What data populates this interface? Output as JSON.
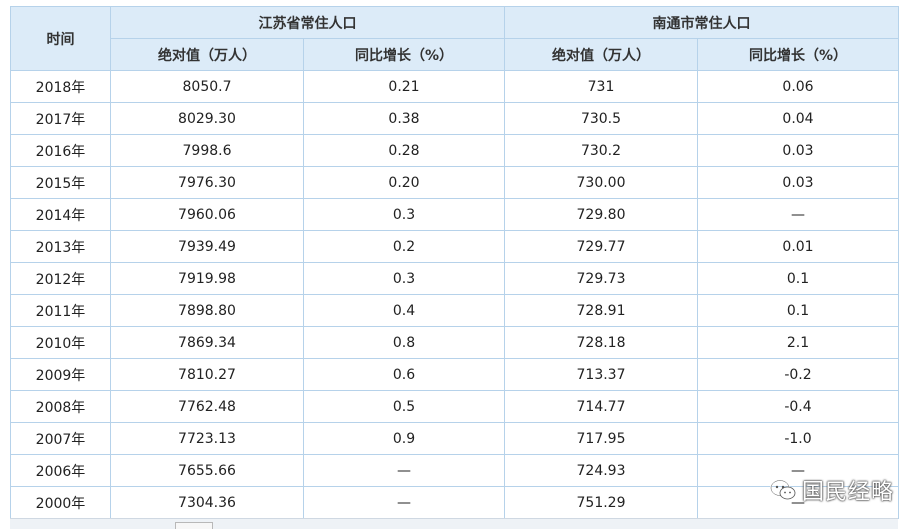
{
  "header": {
    "time": "时间",
    "group_js": "江苏省常住人口",
    "group_nt": "南通市常住人口",
    "abs": "绝对值（万人）",
    "yoy": "同比增长（%）"
  },
  "rows": [
    {
      "year": "2018年",
      "js_abs": "8050.7",
      "js_yoy": "0.21",
      "nt_abs": "731",
      "nt_yoy": "0.06"
    },
    {
      "year": "2017年",
      "js_abs": "8029.30",
      "js_yoy": "0.38",
      "nt_abs": "730.5",
      "nt_yoy": "0.04"
    },
    {
      "year": "2016年",
      "js_abs": "7998.6",
      "js_yoy": "0.28",
      "nt_abs": "730.2",
      "nt_yoy": "0.03"
    },
    {
      "year": "2015年",
      "js_abs": "7976.30",
      "js_yoy": "0.20",
      "nt_abs": "730.00",
      "nt_yoy": "0.03"
    },
    {
      "year": "2014年",
      "js_abs": "7960.06",
      "js_yoy": "0.3",
      "nt_abs": "729.80",
      "nt_yoy": "—"
    },
    {
      "year": "2013年",
      "js_abs": "7939.49",
      "js_yoy": "0.2",
      "nt_abs": "729.77",
      "nt_yoy": "0.01"
    },
    {
      "year": "2012年",
      "js_abs": "7919.98",
      "js_yoy": "0.3",
      "nt_abs": "729.73",
      "nt_yoy": "0.1"
    },
    {
      "year": "2011年",
      "js_abs": "7898.80",
      "js_yoy": "0.4",
      "nt_abs": "728.91",
      "nt_yoy": "0.1"
    },
    {
      "year": "2010年",
      "js_abs": "7869.34",
      "js_yoy": "0.8",
      "nt_abs": "728.18",
      "nt_yoy": "2.1"
    },
    {
      "year": "2009年",
      "js_abs": "7810.27",
      "js_yoy": "0.6",
      "nt_abs": "713.37",
      "nt_yoy": "-0.2"
    },
    {
      "year": "2008年",
      "js_abs": "7762.48",
      "js_yoy": "0.5",
      "nt_abs": "714.77",
      "nt_yoy": "-0.4"
    },
    {
      "year": "2007年",
      "js_abs": "7723.13",
      "js_yoy": "0.9",
      "nt_abs": "717.95",
      "nt_yoy": "-1.0"
    },
    {
      "year": "2006年",
      "js_abs": "7655.66",
      "js_yoy": "—",
      "nt_abs": "724.93",
      "nt_yoy": "—"
    },
    {
      "year": "2000年",
      "js_abs": "7304.36",
      "js_yoy": "—",
      "nt_abs": "751.29",
      "nt_yoy": "—"
    }
  ],
  "watermark": {
    "text": "国民经略",
    "icon": "wechat-icon"
  },
  "colors": {
    "header_bg": "#dcebf8",
    "border": "#b6d2ea"
  }
}
